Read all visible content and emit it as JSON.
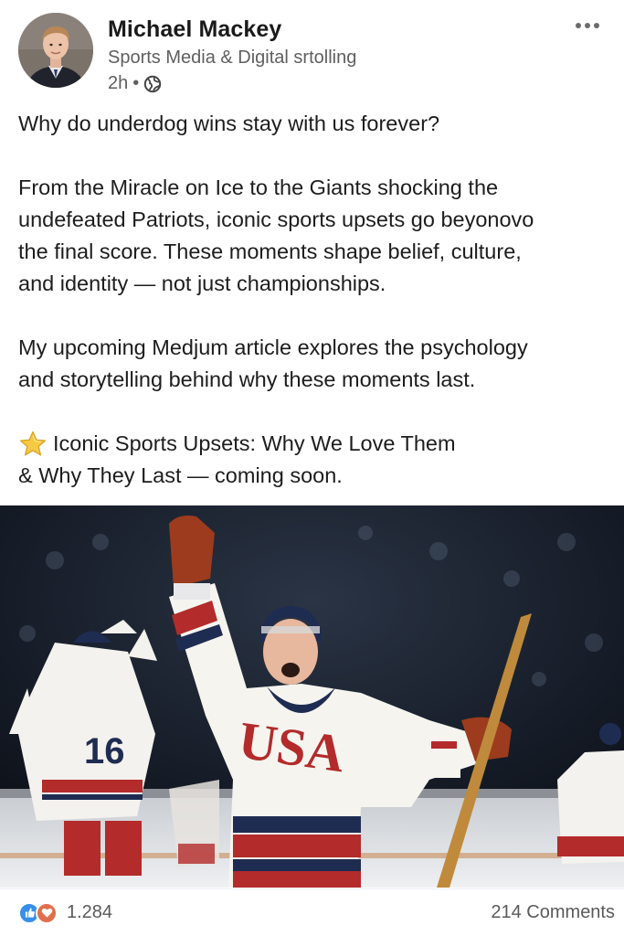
{
  "post": {
    "author": {
      "name": "Michael Mackey",
      "headline": "Sports Media & Digital srtolling",
      "time": "2h",
      "separator": "•",
      "visibility_icon": "globe-icon",
      "avatar_icon": "avatar-photo"
    },
    "menu_icon": "more-options-icon",
    "body": {
      "p1": "Why do underdog wins stay with us forever?",
      "p2_l1": "From the Miracle on Ice to the Giants shocking the",
      "p2_l2": "undefeated Patriots, iconic sports upsets go beyonovo",
      "p2_l3": "the final score. These moments shape belief, culture,",
      "p2_l4": "and identity — not just championships.",
      "p3_l1": "My upcoming Medjum article explores the psychology",
      "p3_l2": "and storytelling behind why these moments last.",
      "headline_icon": "star-icon",
      "headline_l1": "Iconic Sports Upsets: Why We Love Them",
      "headline_l2": "& Why They Last — coming soon."
    },
    "image": {
      "jersey_text": "USA",
      "number_left": "16"
    },
    "footer": {
      "reaction_icons": [
        "like-icon",
        "love-icon"
      ],
      "reaction_count": "1.284",
      "comments": "214 Comments"
    }
  },
  "colors": {
    "like": "#378fe9",
    "love": "#df704d",
    "text": "#1d1d1d",
    "muted": "#5f5f5f",
    "jersey_red": "#b32b2b",
    "jersey_navy": "#1f2c52"
  }
}
